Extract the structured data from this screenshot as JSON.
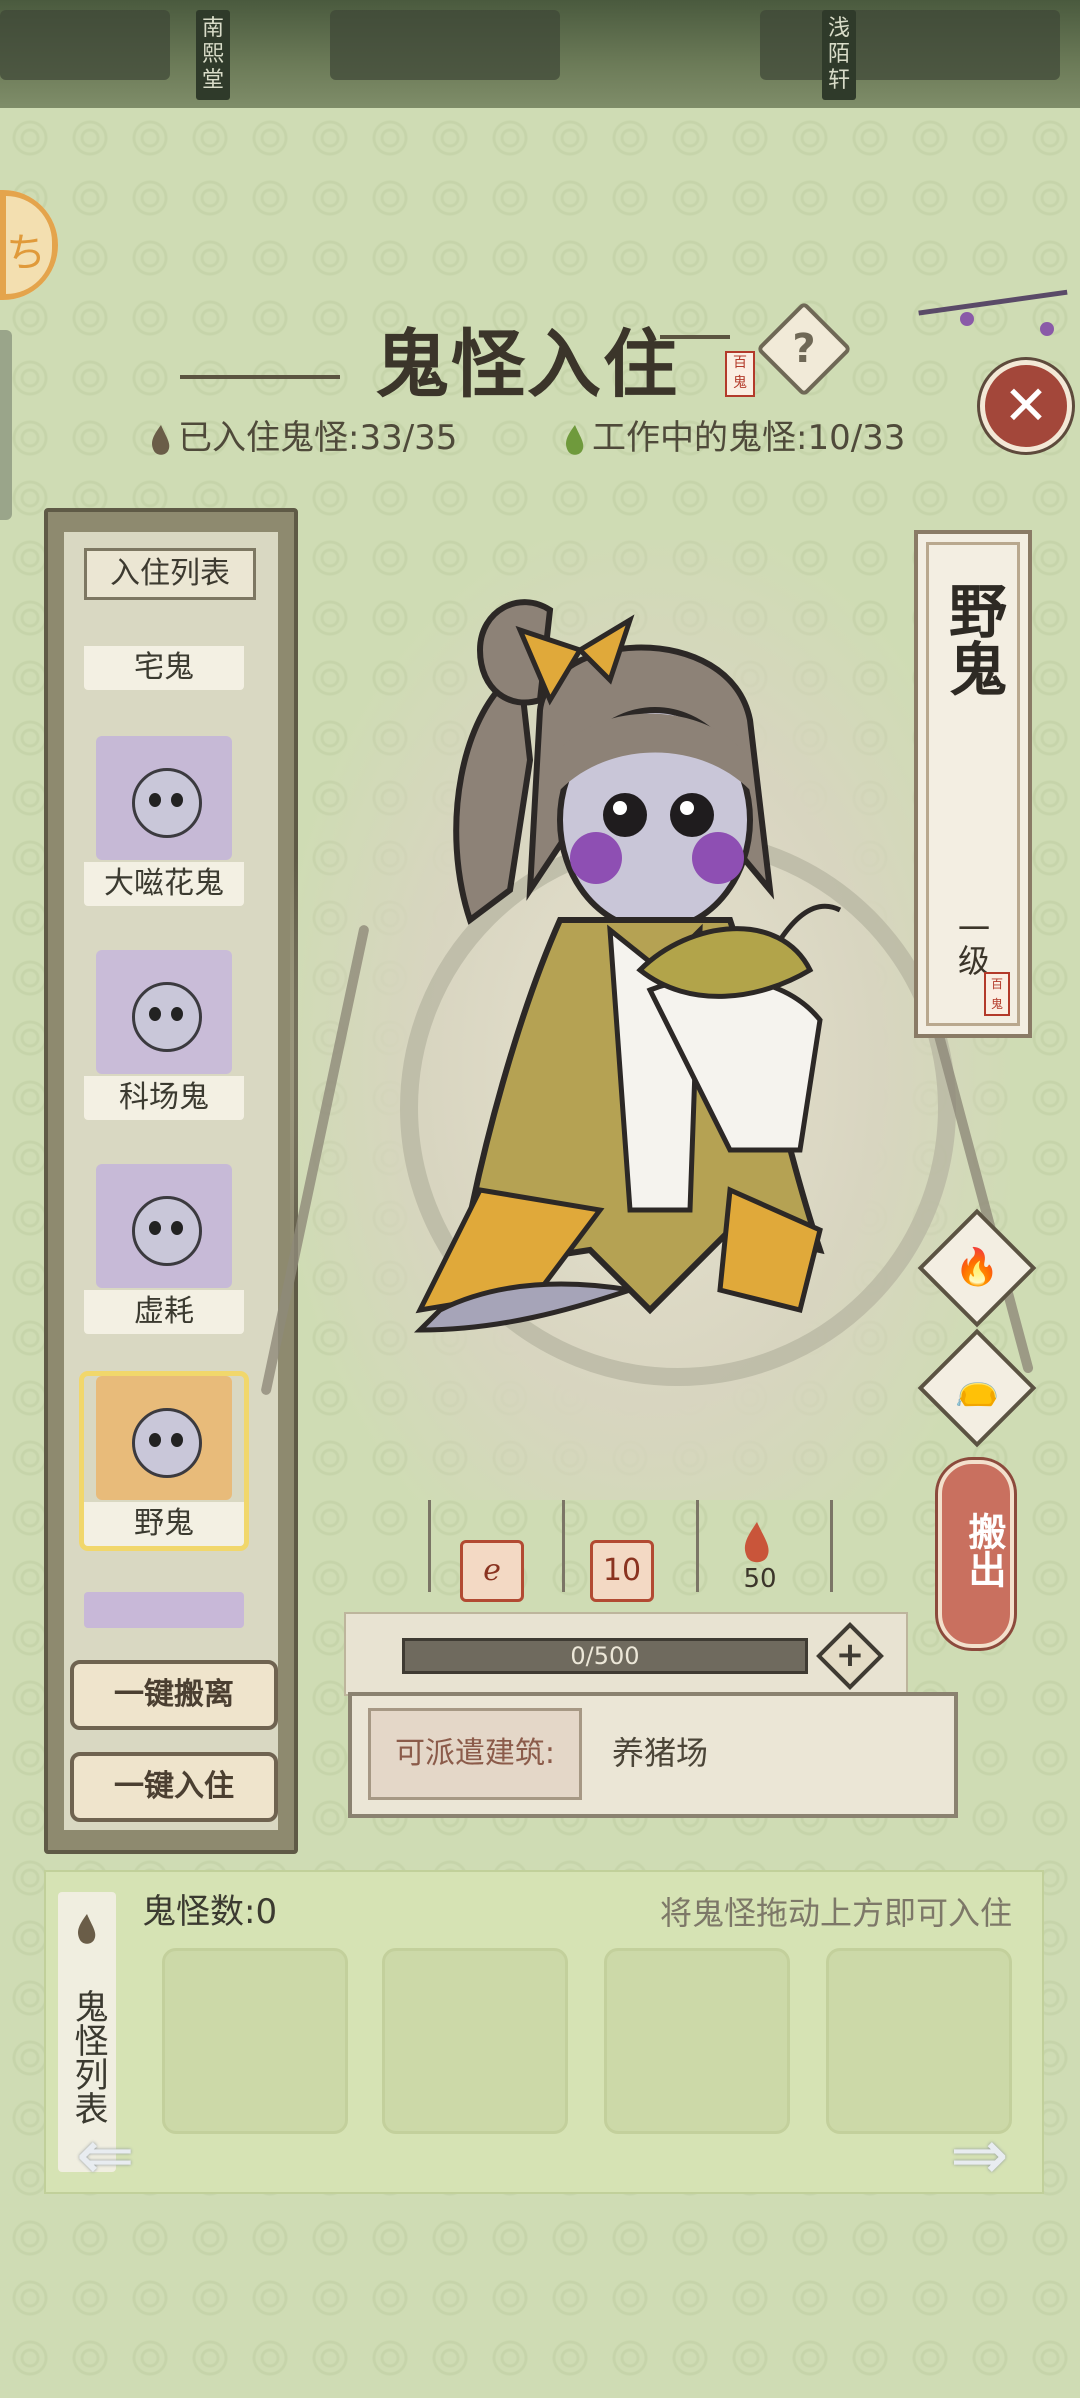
{
  "top_bar": {
    "signs": [
      "南熙堂",
      "浅陌轩"
    ]
  },
  "header": {
    "title": "鬼怪入住",
    "seal_text": "百鬼",
    "help_label": "?",
    "close_label": "✕"
  },
  "stats": {
    "resident": "已入住鬼怪:33/35",
    "working": "工作中的鬼怪:10/33"
  },
  "resident_list": {
    "header": "入住列表",
    "items": [
      {
        "name": "宅鬼"
      },
      {
        "name": "大嗞花鬼"
      },
      {
        "name": "科场鬼"
      },
      {
        "name": "虚耗"
      },
      {
        "name": "野鬼"
      }
    ],
    "remove_all_label": "一键搬离",
    "move_in_all_label": "一键入住"
  },
  "selected_ghost": {
    "name": "野鬼",
    "level": "一级",
    "seal_text": "百鬼",
    "stats": [
      {
        "icon": "skill-icon",
        "value": ""
      },
      {
        "icon": "level-badge-icon",
        "value": "10"
      },
      {
        "icon": "fire-icon",
        "value": "50"
      }
    ],
    "progress_text": "0/500",
    "progress_fraction": 0,
    "move_out_label": "搬出",
    "dispatch_label": "可派遣建筑:",
    "dispatch_value": "养猪场"
  },
  "ghost_bank": {
    "tab_label": "鬼怪列表",
    "count_text": "鬼怪数:0",
    "hint": "将鬼怪拖动上方即可入住"
  },
  "colors": {
    "panel_bg": "#cfdcb4",
    "close_red": "#a3473a",
    "move_out_red": "#c9705f",
    "selected_glow": "#f1d76b"
  }
}
